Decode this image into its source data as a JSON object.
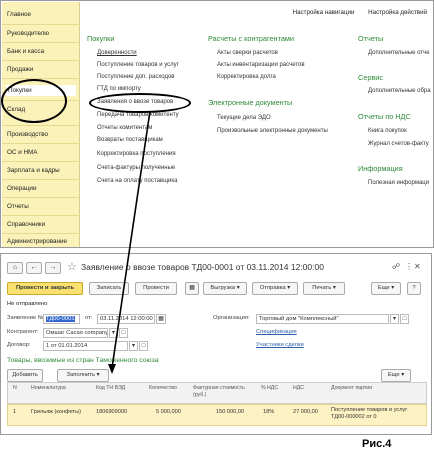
{
  "sidebar": {
    "items": [
      "Главное",
      "Руководителю",
      "Банк и касса",
      "Продажи",
      "Покупки",
      "Склад",
      "Производство",
      "ОС и НМА",
      "Зарплата и кадры",
      "Операции",
      "Отчеты",
      "Справочники",
      "Администрирование"
    ]
  },
  "topbar": {
    "nav_settings": "Настройка навигации",
    "action_settings": "Настройка действий"
  },
  "sections": {
    "purchases": {
      "title": "Покупки",
      "items": [
        "Доверенности",
        "Поступление товаров и услуг",
        "Поступление доп. расходов",
        "ГТД по импорту",
        "Заявления о ввозе товаров",
        "Передача товаров комитенту",
        "Отчеты комитентам",
        "Возвраты поставщикам",
        "Корректировка поступления",
        "Счета-фактуры полученные",
        "Счета на оплату поставщика"
      ]
    },
    "settlements": {
      "title": "Расчеты с контрагентами",
      "items": [
        "Акты сверки расчетов",
        "Акты инвентаризации расчетов",
        "Корректировка долга"
      ]
    },
    "edocs": {
      "title": "Электронные документы",
      "items": [
        "Текущие дела ЭДО",
        "Произвольные электронные документы"
      ]
    },
    "reports": {
      "title": "Отчеты",
      "items": [
        "Дополнительные отче"
      ]
    },
    "service": {
      "title": "Сервис",
      "items": [
        "Дополнительные обра"
      ]
    },
    "vat": {
      "title": "Отчеты по НДС",
      "items": [
        "Книга покупок",
        "Журнал счетов-факту"
      ]
    },
    "info": {
      "title": "Информация",
      "items": [
        "Полезная информаци"
      ]
    }
  },
  "document": {
    "title": "Заявление о ввозе товаров ТД00-0001 от 03.11.2014 12:00:00",
    "toolbar": {
      "post_close": "Провести и закрыть",
      "save": "Записать",
      "post": "Провести",
      "upload": "Выгрузка",
      "send": "Отправка",
      "print": "Печать",
      "more": "Еще"
    },
    "status": "Не отправлено",
    "fields": {
      "number_label": "Заявление №:",
      "number_value": "ТД00-0001",
      "date_label": "от:",
      "date_value": "03.11.2014 12:00:00",
      "org_label": "Организация:",
      "org_value": "Торговый дом \"Комплексный\"",
      "counterparty_label": "Контрагент:",
      "counterparty_value": "Омшаг Сасао company",
      "spec_link": "Спецификация",
      "contract_label": "Договор:",
      "contract_value": "1 от 01.01.2014",
      "participants_link": "Участники сделки"
    },
    "table_heading": "Товары, ввозимые из стран Таможенного союза",
    "table_toolbar": {
      "add": "Добавить",
      "fill": "Заполнить",
      "more": "Еще"
    },
    "columns": [
      "N",
      "Номенклатура",
      "Код ТН ВЭД",
      "Количество",
      "Фактурная стоимость (руб.)",
      "% НДС",
      "НДС",
      "Документ партии"
    ],
    "rows": [
      [
        "1",
        "Грильяж (конфеты)",
        "1806909000",
        "5 000,000",
        "150 000,00",
        "18%",
        "27 000,00",
        "Поступление товаров и услуг ТД00-000002 от 0"
      ]
    ]
  },
  "figure_label": "Рис.4"
}
